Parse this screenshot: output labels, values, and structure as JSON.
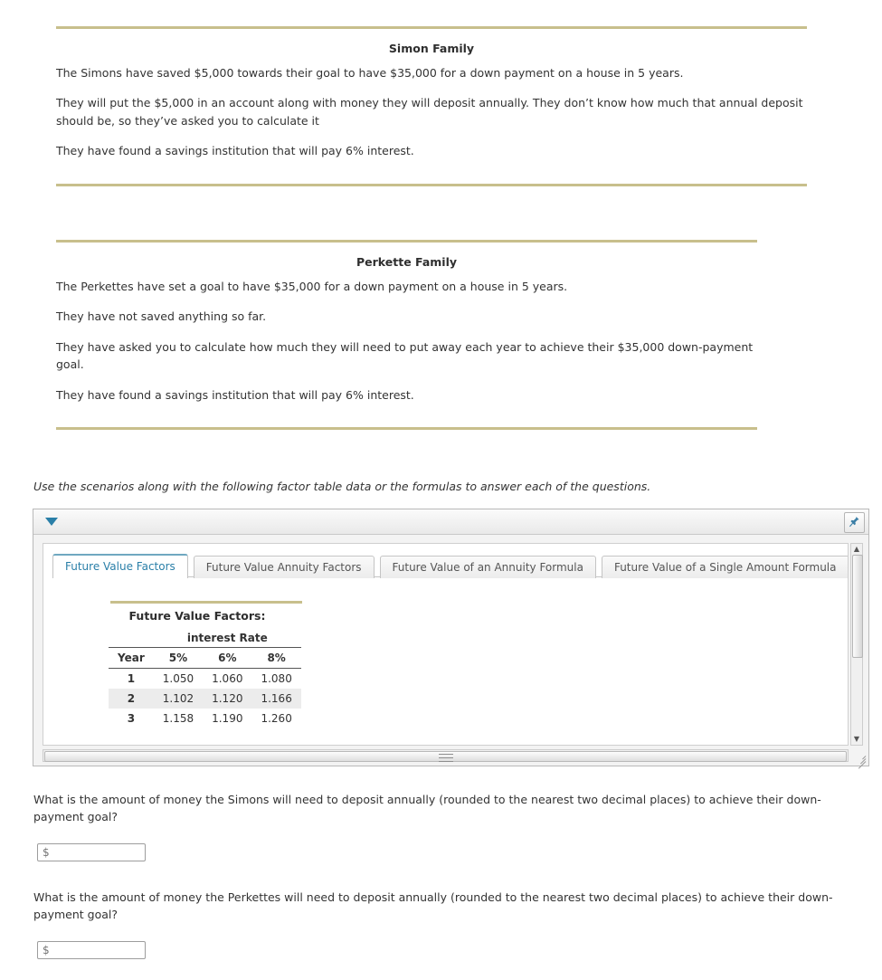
{
  "simon": {
    "title": "Simon Family",
    "lines": [
      "The Simons have saved $5,000 towards their goal to have $35,000 for a down payment on a house in 5 years.",
      "They will put the $5,000 in an account along with money they will deposit annually. They don’t know how much that annual deposit should be, so they’ve asked you to calculate it",
      "They have found a savings institution that will pay 6% interest."
    ]
  },
  "perkette": {
    "title": "Perkette Family",
    "lines": [
      "The Perkettes have set a goal to have $35,000 for a down payment on a house in 5 years.",
      "They have not saved anything so far.",
      "They have asked you to calculate how much they will need to put away each year to achieve their $35,000 down-payment goal.",
      "They have found a savings institution that will pay 6% interest."
    ]
  },
  "instruction": "Use the scenarios along with the following factor table data or the formulas to answer each of the questions.",
  "widget": {
    "toggle_icon": "triangle-down-icon",
    "pin_icon": "pin-icon",
    "tabs": [
      {
        "label": "Future Value Factors",
        "active": true
      },
      {
        "label": "Future Value Annuity Factors",
        "active": false
      },
      {
        "label": "Future Value of an Annuity Formula",
        "active": false
      },
      {
        "label": "Future Value of a Single Amount Formula",
        "active": false
      }
    ],
    "table": {
      "title": "Future Value Factors:",
      "group_header": "interest Rate",
      "columns": [
        "Year",
        "5%",
        "6%",
        "8%"
      ],
      "rows": [
        [
          "1",
          "1.050",
          "1.060",
          "1.080"
        ],
        [
          "2",
          "1.102",
          "1.120",
          "1.166"
        ],
        [
          "3",
          "1.158",
          "1.190",
          "1.260"
        ]
      ]
    }
  },
  "questions": [
    {
      "text": "What is the amount of money the Simons will need to deposit annually (rounded to the nearest two decimal places) to achieve their down-payment goal?",
      "answer_value": "",
      "answer_placeholder": "$"
    },
    {
      "text": "What is the amount of money the Perkettes will need to deposit annually (rounded to the nearest two decimal places) to achieve their down-payment goal?",
      "answer_value": "",
      "answer_placeholder": "$"
    }
  ]
}
